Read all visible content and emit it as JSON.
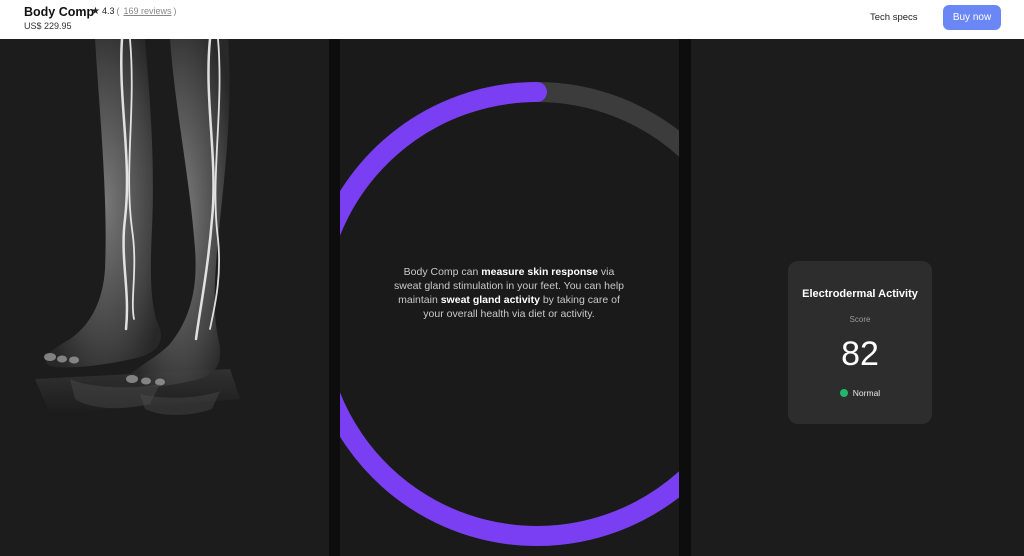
{
  "header": {
    "product_title": "Body Comp",
    "rating_value": "4.3",
    "reviews_link": "169 reviews",
    "price": "US$ 229.95",
    "tech_specs_link": "Tech specs",
    "buy_button": "Buy now"
  },
  "ring_panel": {
    "text_1": "Body Comp can ",
    "bold_1": "measure skin response",
    "text_2": " via sweat gland stimulation in your feet. You can help maintain ",
    "bold_2": "sweat gland activity",
    "text_3": " by taking care of your overall health via diet or activity."
  },
  "score_card": {
    "title": "Electrodermal Activity",
    "subtitle": "Score",
    "score": "82",
    "status": "Normal"
  },
  "colors": {
    "accent_blue": "#6b87f5",
    "ring_purple": "#7a3ff2",
    "ring_track": "#3c3c3c",
    "status_green": "#21b66b",
    "panel_bg": "#1c1c1c"
  },
  "icons": [
    "star-icon",
    "status-dot-icon"
  ]
}
